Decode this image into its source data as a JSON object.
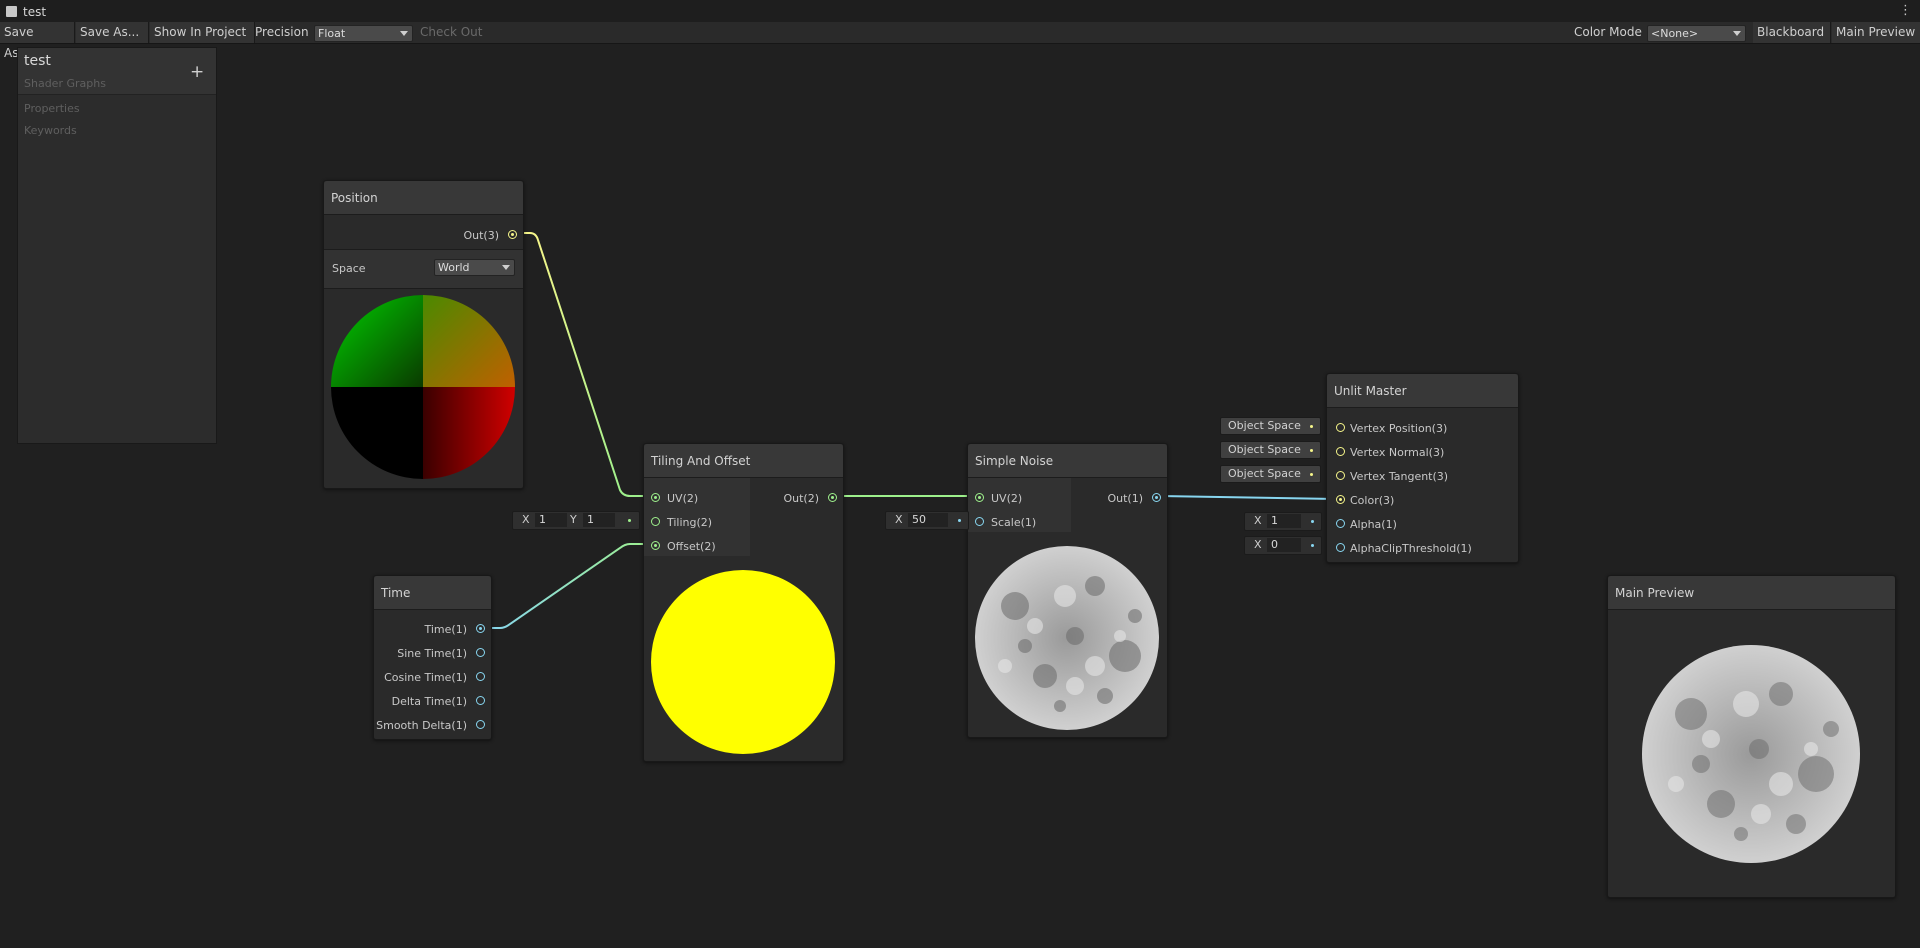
{
  "window": {
    "tab_title": "test"
  },
  "toolbar": {
    "save_asset": "Save Asset",
    "save_as": "Save As...",
    "show_in_project": "Show In Project",
    "precision_label": "Precision",
    "precision_value": "Float",
    "check_out": "Check Out",
    "color_mode_label": "Color Mode",
    "color_mode_value": "<None>",
    "blackboard": "Blackboard",
    "main_preview": "Main Preview"
  },
  "blackboard": {
    "title": "test",
    "subtitle": "Shader Graphs",
    "add": "+",
    "sections": [
      "Properties",
      "Keywords"
    ]
  },
  "nodes": {
    "position": {
      "title": "Position",
      "output": "Out(3)",
      "space_label": "Space",
      "space_value": "World"
    },
    "tiling": {
      "title": "Tiling And Offset",
      "inputs": [
        "UV(2)",
        "Tiling(2)",
        "Offset(2)"
      ],
      "output": "Out(2)",
      "tiling_x_label": "X",
      "tiling_x": "1",
      "tiling_y_label": "Y",
      "tiling_y": "1"
    },
    "noise": {
      "title": "Simple Noise",
      "inputs": [
        "UV(2)",
        "Scale(1)"
      ],
      "output": "Out(1)",
      "scale_x_label": "X",
      "scale_x": "50"
    },
    "time": {
      "title": "Time",
      "outputs": [
        "Time(1)",
        "Sine Time(1)",
        "Cosine Time(1)",
        "Delta Time(1)",
        "Smooth Delta(1)"
      ]
    },
    "master": {
      "title": "Unlit Master",
      "inputs": [
        "Vertex Position(3)",
        "Vertex Normal(3)",
        "Vertex Tangent(3)",
        "Color(3)",
        "Alpha(1)",
        "AlphaClipThreshold(1)"
      ],
      "space_fields": [
        "Object Space",
        "Object Space",
        "Object Space"
      ],
      "alpha_x_label": "X",
      "alpha": "1",
      "clip_x_label": "X",
      "clip": "0"
    }
  },
  "main_preview": {
    "title": "Main Preview"
  },
  "colors": {
    "vector3": "#f5f58a",
    "vector2": "#9ef08c",
    "vector1": "#88d6f0",
    "background": "#202020"
  }
}
